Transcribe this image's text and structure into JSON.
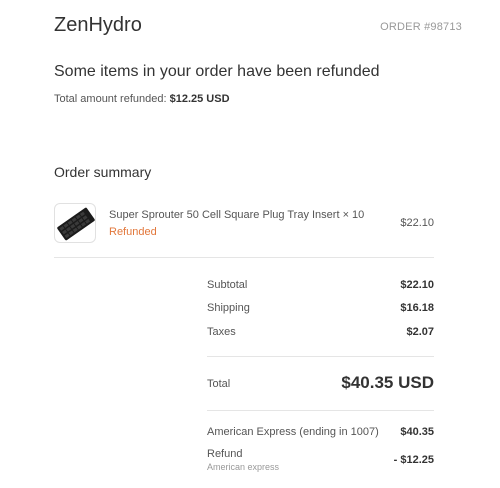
{
  "header": {
    "shop_name": "ZenHydro",
    "order_number": "ORDER #98713"
  },
  "refund": {
    "heading": "Some items in your order have been refunded",
    "total_label": "Total amount refunded:",
    "total_amount": "$12.25 USD"
  },
  "summary": {
    "heading": "Order summary",
    "items": [
      {
        "title": "Super Sprouter 50 Cell Square Plug Tray Insert × 10",
        "status": "Refunded",
        "price": "$22.10",
        "icon": "plug-tray-image"
      }
    ]
  },
  "totals": {
    "subtotal_label": "Subtotal",
    "subtotal_value": "$22.10",
    "shipping_label": "Shipping",
    "shipping_value": "$16.18",
    "taxes_label": "Taxes",
    "taxes_value": "$2.07",
    "total_label": "Total",
    "total_value": "$40.35 USD"
  },
  "payments": {
    "card_label": "American Express (ending in 1007)",
    "card_value": "$40.35",
    "refund_label": "Refund",
    "refund_method": "American express",
    "refund_value": "- $12.25"
  },
  "colors": {
    "refunded_status": "#e2773b",
    "text": "#333333",
    "muted": "#999999"
  }
}
